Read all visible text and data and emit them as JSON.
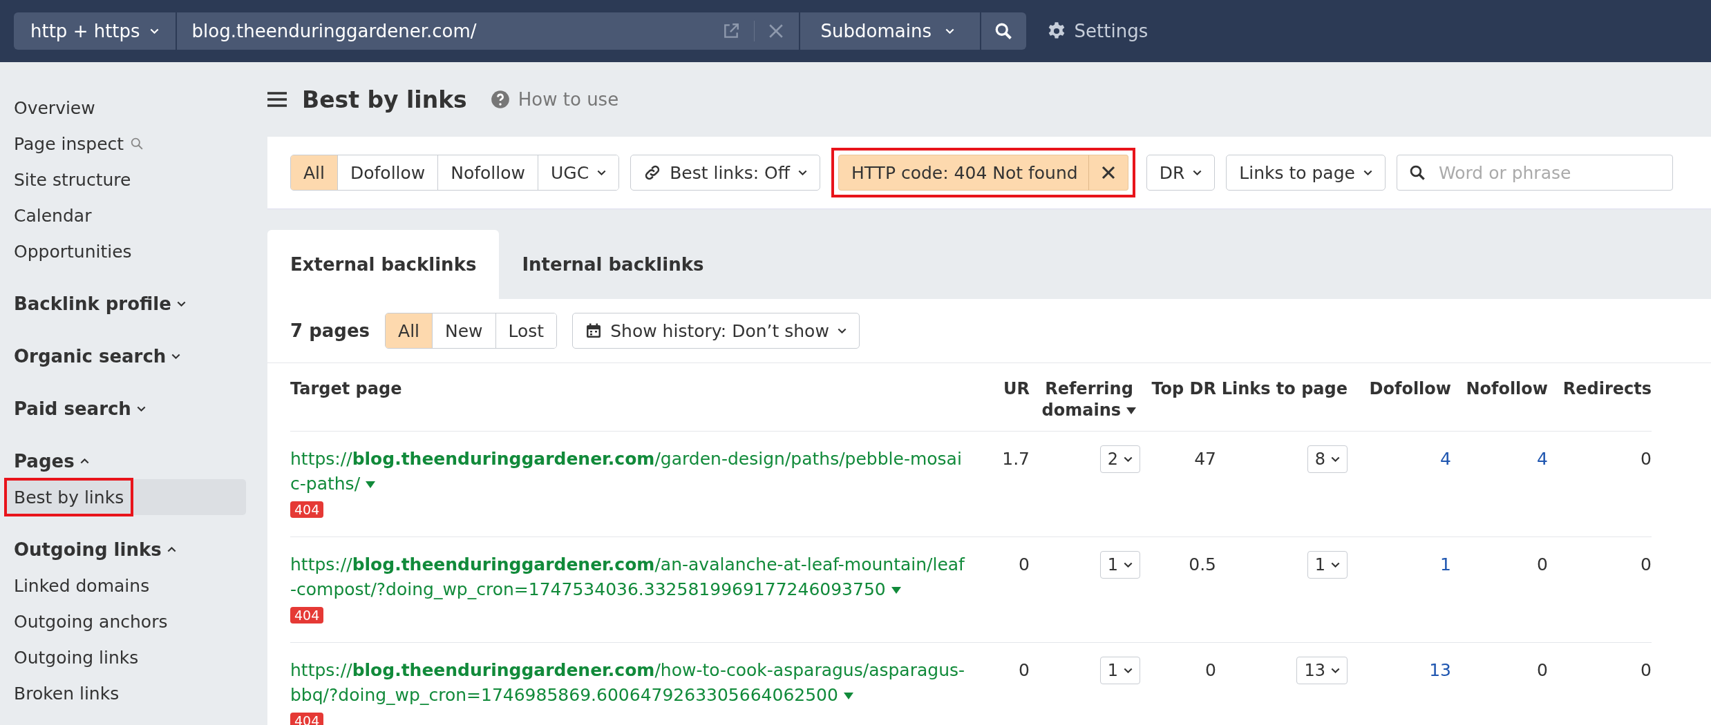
{
  "topbar": {
    "protocol": "http + https",
    "url": "blog.theenduringgardener.com/",
    "scope": "Subdomains",
    "settings": "Settings"
  },
  "sidebar": [
    {
      "kind": "plain",
      "items": [
        {
          "label": "Overview",
          "search": false,
          "selected": false,
          "highlighted": false
        },
        {
          "label": "Page inspect",
          "search": true,
          "selected": false,
          "highlighted": false
        },
        {
          "label": "Site structure",
          "search": false,
          "selected": false,
          "highlighted": false
        },
        {
          "label": "Calendar",
          "search": false,
          "selected": false,
          "highlighted": false
        },
        {
          "label": "Opportunities",
          "search": false,
          "selected": false,
          "highlighted": false
        }
      ]
    },
    {
      "kind": "section",
      "title": "Backlink profile",
      "expanded": false
    },
    {
      "kind": "section",
      "title": "Organic search",
      "expanded": false
    },
    {
      "kind": "section",
      "title": "Paid search",
      "expanded": false
    },
    {
      "kind": "section",
      "title": "Pages",
      "expanded": true,
      "items": [
        {
          "label": "Best by links",
          "search": false,
          "selected": true,
          "highlighted": true
        }
      ]
    },
    {
      "kind": "section",
      "title": "Outgoing links",
      "expanded": true,
      "items": [
        {
          "label": "Linked domains",
          "search": false,
          "selected": false,
          "highlighted": false
        },
        {
          "label": "Outgoing anchors",
          "search": false,
          "selected": false,
          "highlighted": false
        },
        {
          "label": "Outgoing links",
          "search": false,
          "selected": false,
          "highlighted": false
        },
        {
          "label": "Broken links",
          "search": false,
          "selected": false,
          "highlighted": false
        }
      ]
    }
  ],
  "header": {
    "title": "Best by links",
    "help": "How to use"
  },
  "filters": [
    {
      "kind": "segmented",
      "options": [
        {
          "label": "All",
          "selected": true
        },
        {
          "label": "Dofollow",
          "selected": false
        },
        {
          "label": "Nofollow",
          "selected": false
        },
        {
          "label": "UGC",
          "selected": false,
          "dropdown": true
        }
      ]
    },
    {
      "kind": "links-toggle",
      "label": "Best links: Off",
      "highlighted": false
    },
    {
      "kind": "chip",
      "label": "HTTP code: 404 Not found",
      "highlighted": true
    },
    {
      "kind": "dropdown",
      "label": "DR",
      "highlighted": false
    },
    {
      "kind": "dropdown",
      "label": "Links to page",
      "highlighted": false
    },
    {
      "kind": "search",
      "placeholder": "Word or phrase"
    }
  ],
  "tabs": [
    {
      "label": "External backlinks",
      "selected": true
    },
    {
      "label": "Internal backlinks",
      "selected": false
    }
  ],
  "summary": {
    "count": "7 pages",
    "options": [
      {
        "label": "All",
        "selected": true
      },
      {
        "label": "New",
        "selected": false
      },
      {
        "label": "Lost",
        "selected": false
      }
    ],
    "history": "Show history: Don’t show"
  },
  "table": {
    "columns": [
      {
        "label": "Target page",
        "sorted": false
      },
      {
        "label": "UR",
        "sorted": false
      },
      {
        "label": "Referring domains",
        "sorted": true
      },
      {
        "label": "Top DR",
        "sorted": false
      },
      {
        "label": "Links to page",
        "sorted": false
      },
      {
        "label": "Dofollow",
        "sorted": false
      },
      {
        "label": "Nofollow",
        "sorted": false
      },
      {
        "label": "Redirects",
        "sorted": false
      }
    ],
    "rows": [
      {
        "url": "https://**blog.theenduringgardener.com**/garden-design/paths/pebble-mosaic-paths/",
        "status": "404",
        "ur": "1.7",
        "referring_domains": "2",
        "top_dr": "47",
        "links_to_page": "8",
        "dofollow": {
          "value": "4",
          "link": true
        },
        "nofollow": {
          "value": "4",
          "link": true
        },
        "redirects": "0"
      },
      {
        "url": "https://**blog.theenduringgardener.com**/an-avalanche-at-leaf-mountain/leaf-compost/?doing_wp_cron=1747534036.3325819969177246093750",
        "status": "404",
        "ur": "0",
        "referring_domains": "1",
        "top_dr": "0.5",
        "links_to_page": "1",
        "dofollow": {
          "value": "1",
          "link": true
        },
        "nofollow": {
          "value": "0",
          "link": false
        },
        "redirects": "0"
      },
      {
        "url": "https://**blog.theenduringgardener.com**/how-to-cook-asparagus/asparagus-bbq/?doing_wp_cron=1746985869.6006479263305664062500",
        "status": "404",
        "ur": "0",
        "referring_domains": "1",
        "top_dr": "0",
        "links_to_page": "13",
        "dofollow": {
          "value": "13",
          "link": true
        },
        "nofollow": {
          "value": "0",
          "link": false
        },
        "redirects": "0"
      }
    ]
  }
}
